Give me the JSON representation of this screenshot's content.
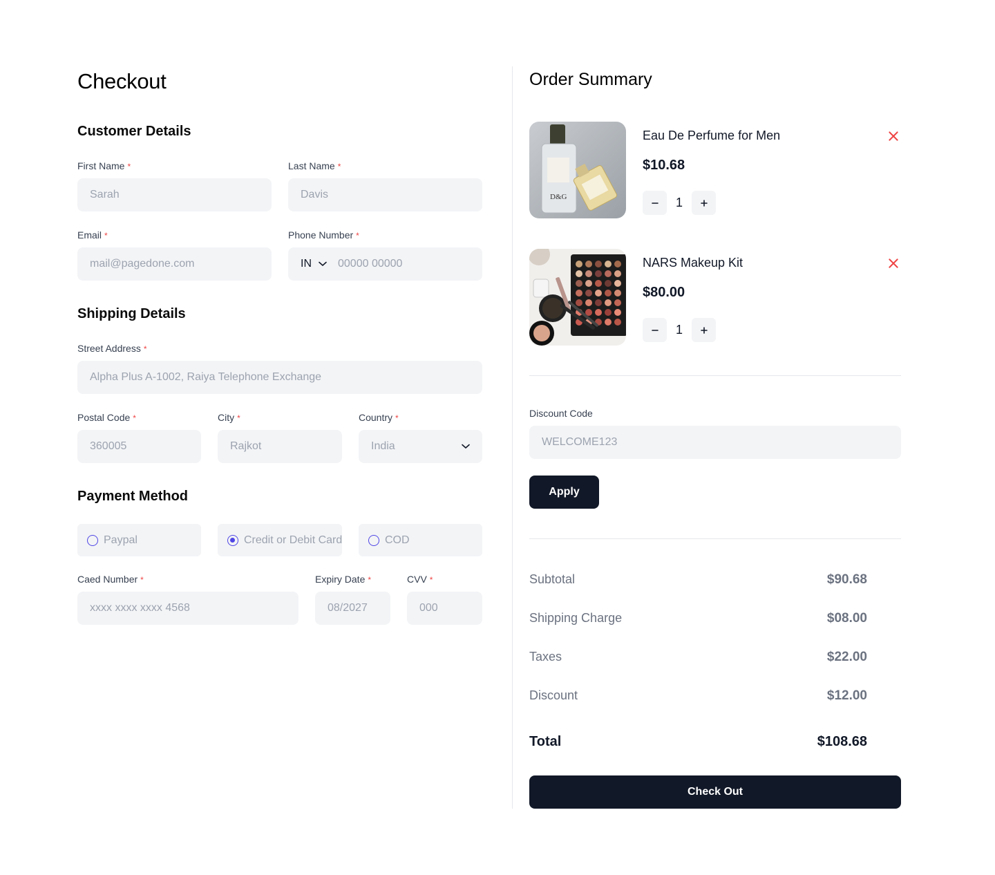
{
  "checkout": {
    "title": "Checkout",
    "required_mark": "*",
    "customer": {
      "heading": "Customer Details",
      "first_name": {
        "label": "First Name",
        "placeholder": "Sarah"
      },
      "last_name": {
        "label": "Last Name",
        "placeholder": "Davis"
      },
      "email": {
        "label": "Email",
        "placeholder": "mail@pagedone.com"
      },
      "phone": {
        "label": "Phone Number",
        "country_code": "IN",
        "placeholder": "00000 00000"
      }
    },
    "shipping": {
      "heading": "Shipping Details",
      "street": {
        "label": "Street Address",
        "placeholder": "Alpha Plus A-1002, Raiya Telephone Exchange"
      },
      "postal": {
        "label": "Postal Code",
        "placeholder": "360005"
      },
      "city": {
        "label": "City",
        "placeholder": "Rajkot"
      },
      "country": {
        "label": "Country",
        "value": "India"
      }
    },
    "payment": {
      "heading": "Payment Method",
      "options": [
        {
          "label": "Paypal",
          "selected": false
        },
        {
          "label": "Credit or Debit Card",
          "selected": true
        },
        {
          "label": "COD",
          "selected": false
        }
      ],
      "card_number": {
        "label": "Caed Number",
        "placeholder": "xxxx xxxx xxxx 4568"
      },
      "expiry": {
        "label": "Expiry Date",
        "placeholder": "08/2027"
      },
      "cvv": {
        "label": "CVV",
        "placeholder": "000"
      }
    }
  },
  "summary": {
    "title": "Order Summary",
    "items": [
      {
        "name": "Eau De Perfume for Men",
        "price": "$10.68",
        "qty": "1",
        "image": "perfume-bottles-photo"
      },
      {
        "name": "NARS Makeup Kit",
        "price": "$80.00",
        "qty": "1",
        "image": "makeup-palette-photo"
      }
    ],
    "discount": {
      "label": "Discount Code",
      "placeholder": "WELCOME123",
      "apply_label": "Apply"
    },
    "totals": {
      "subtotal_label": "Subtotal",
      "subtotal": "$90.68",
      "shipping_label": "Shipping Charge",
      "shipping": "$08.00",
      "taxes_label": "Taxes",
      "taxes": "$22.00",
      "discount_label": "Discount",
      "discount": "$12.00",
      "total_label": "Total",
      "total": "$108.68"
    },
    "checkout_label": "Check Out"
  },
  "colors": {
    "accent": "#4f46e5",
    "dark_button": "#111827",
    "required": "#ef4444",
    "input_bg": "#f3f4f6"
  },
  "icons": {
    "remove": "close-icon",
    "minus": "minus-icon",
    "plus": "plus-icon",
    "dropdown": "chevron-down-icon"
  }
}
